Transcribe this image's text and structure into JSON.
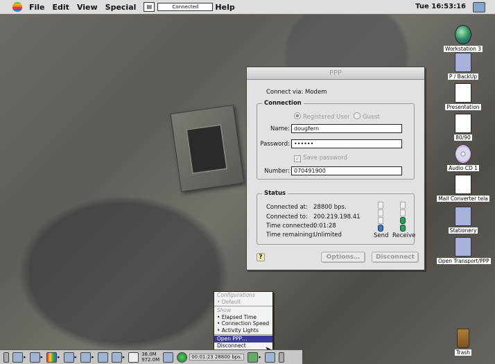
{
  "menubar": {
    "items": [
      "File",
      "Edit",
      "View",
      "Special",
      "Help"
    ],
    "status_field": "Connected",
    "clock": "Tue 16:53:16"
  },
  "desktop_icons": [
    {
      "label": "Workstation 3",
      "icon": "globe-icon"
    },
    {
      "label": "P / BackUp",
      "icon": "folder-icon"
    },
    {
      "label": "Presentation",
      "icon": "document-icon"
    },
    {
      "label": "80/90",
      "icon": "document-icon"
    },
    {
      "label": "Audio CD 1",
      "icon": "cd-icon"
    },
    {
      "label": "Mail Converter tela",
      "icon": "document-icon"
    },
    {
      "label": "Stationery",
      "icon": "folder-icon"
    },
    {
      "label": "Open Transport/PPP",
      "icon": "folder-icon"
    },
    {
      "label": "Trash",
      "icon": "trash-icon"
    }
  ],
  "ppp": {
    "title": "PPP",
    "connect_via": "Connect via:  Modem",
    "connection": {
      "group_title": "Connection",
      "registered_user": "Registered User",
      "guest": "Guest",
      "name_label": "Name:",
      "name_value": "dougfern",
      "password_label": "Password:",
      "password_value": "••••••",
      "save_password": "Save password",
      "number_label": "Number:",
      "number_value": "070491900"
    },
    "status": {
      "group_title": "Status",
      "connected_at_label": "Connected at:",
      "connected_at_value": "28800 bps.",
      "connected_to_label": "Connected to:",
      "connected_to_value": "200.219.198.41",
      "time_connected_label": "Time connected:",
      "time_connected_value": "0:01:28",
      "time_remaining_label": "Time remaining:",
      "time_remaining_value": "Unlimited",
      "send_label": "Send",
      "receive_label": "Receive"
    },
    "buttons": {
      "options": "Options…",
      "disconnect": "Disconnect"
    },
    "help_glyph": "?"
  },
  "popup_menu": {
    "items": [
      {
        "label": "Configurations",
        "style": "dim"
      },
      {
        "label": "• Default",
        "style": "dim"
      },
      {
        "label": "Show",
        "style": "dim"
      },
      {
        "label": "• Elapsed Time",
        "style": "normal"
      },
      {
        "label": "• Connection Speed",
        "style": "normal"
      },
      {
        "label": "• Activity Lights",
        "style": "normal"
      },
      {
        "label": "Open PPP…",
        "style": "selected"
      },
      {
        "label": "Disconnect",
        "style": "normal"
      }
    ]
  },
  "control_strip": {
    "memory_top": "38.0M",
    "memory_bottom": "972.0M",
    "ppp_status": "00:01:23  28800 bps."
  },
  "colors": {
    "menu_highlight": "#3b3b8f",
    "window_bg": "#e2e2e2"
  }
}
